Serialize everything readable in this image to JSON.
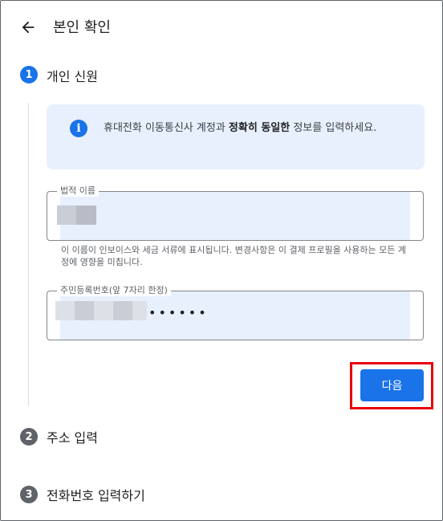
{
  "header": {
    "title": "본인 확인"
  },
  "steps": [
    {
      "number": "1",
      "title": "개인 신원",
      "state": "active"
    },
    {
      "number": "2",
      "title": "주소 입력",
      "state": "inactive"
    },
    {
      "number": "3",
      "title": "전화번호 입력하기",
      "state": "inactive"
    }
  ],
  "info": {
    "text_before": "휴대전화 이동통신사 계정과 ",
    "text_bold": "정확히 동일한",
    "text_after": " 정보를 입력하세요."
  },
  "legal_name": {
    "label": "법적 이름",
    "value_redacted": true
  },
  "helper_text": "이 이름이 인보이스와 세금 서류에 표시됩니다. 변경사항은 이 결제 프로필을 사용하는 모든 계정에 영향을 미칩니다.",
  "resident_number": {
    "label": "주민등록번호(앞 7자리 한정)",
    "masked_suffix": "••••••"
  },
  "actions": {
    "next_label": "다음"
  },
  "colors": {
    "accent": "#1a73e8",
    "info_bg": "#e8f0fe",
    "highlight": "#e8000b"
  }
}
